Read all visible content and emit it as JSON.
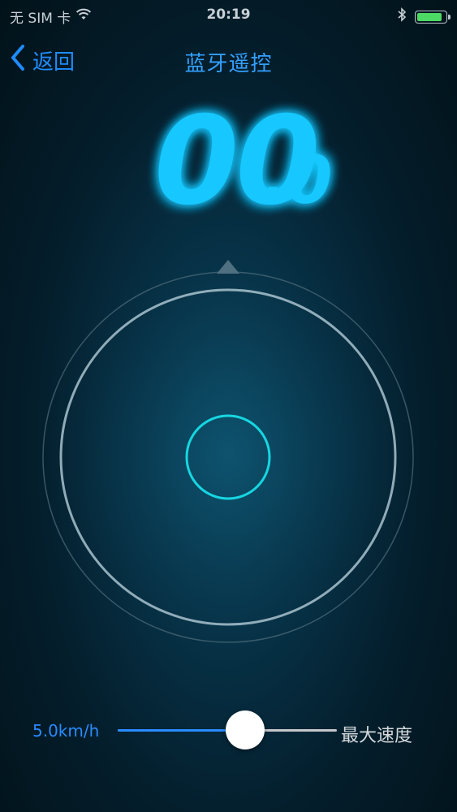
{
  "status_bar": {
    "carrier": "无 SIM 卡",
    "time": "20:19",
    "battery_level": 0.9,
    "icons": [
      "wifi-icon",
      "bluetooth-icon",
      "battery-icon"
    ]
  },
  "nav": {
    "back_label": "返回",
    "title": "蓝牙遥控"
  },
  "speed": {
    "integer": "00",
    "decimal": "0",
    "color": "#19c8ff"
  },
  "joystick": {
    "ring_color": "#a9c3cf",
    "knob_color": "#16d6e0"
  },
  "slider": {
    "value_label": "5.0km/h",
    "label": "最大速度",
    "fraction": 0.58,
    "fill_color": "#2a8bff"
  }
}
